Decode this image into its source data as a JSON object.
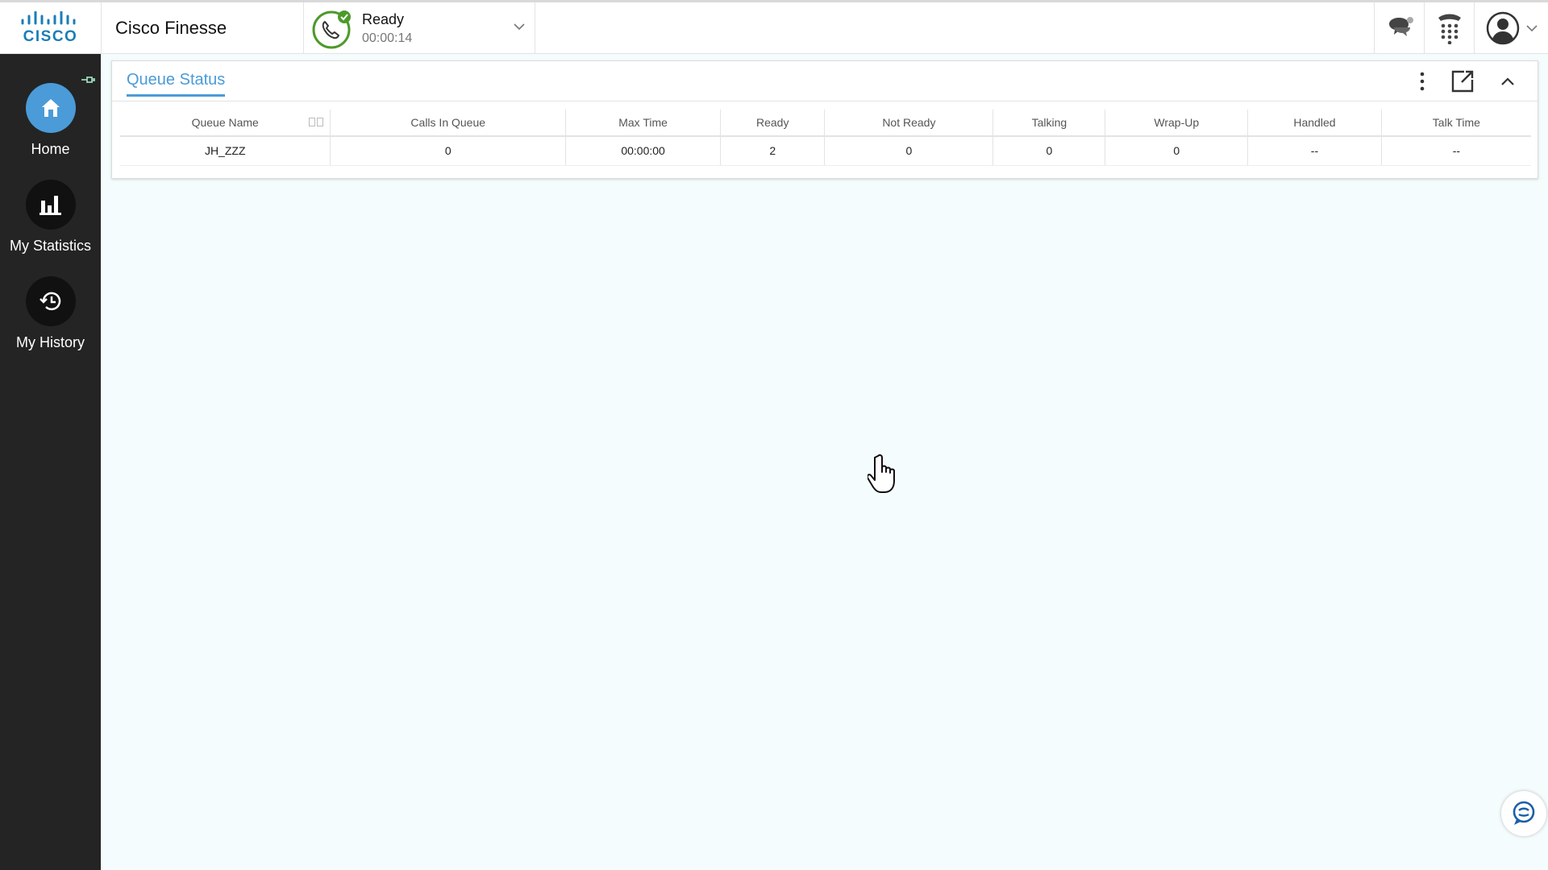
{
  "header": {
    "logo_text": "CISCO",
    "app_title": "Cisco Finesse",
    "status": {
      "label": "Ready",
      "timer": "00:00:14",
      "color": "#4c9a2a"
    },
    "icons": [
      "chat-bubble-icon",
      "dialpad-icon",
      "user-avatar-icon",
      "chevron-down-icon"
    ]
  },
  "sidebar": {
    "items": [
      {
        "label": "Home",
        "icon": "home-icon",
        "active": true
      },
      {
        "label": "My Statistics",
        "icon": "bar-chart-icon",
        "active": false
      },
      {
        "label": "My History",
        "icon": "history-icon",
        "active": false
      }
    ]
  },
  "gadget": {
    "title": "Queue Status",
    "columns": [
      "Queue Name",
      "Calls In Queue",
      "Max Time",
      "Ready",
      "Not Ready",
      "Talking",
      "Wrap-Up",
      "Handled",
      "Talk Time"
    ],
    "rows": [
      [
        "JH_ZZZ",
        "0",
        "00:00:00",
        "2",
        "0",
        "0",
        "0",
        "--",
        "--"
      ]
    ]
  },
  "colors": {
    "accent": "#4a9bd8",
    "sidebar": "#242424",
    "ready_green": "#4c9a2a"
  }
}
